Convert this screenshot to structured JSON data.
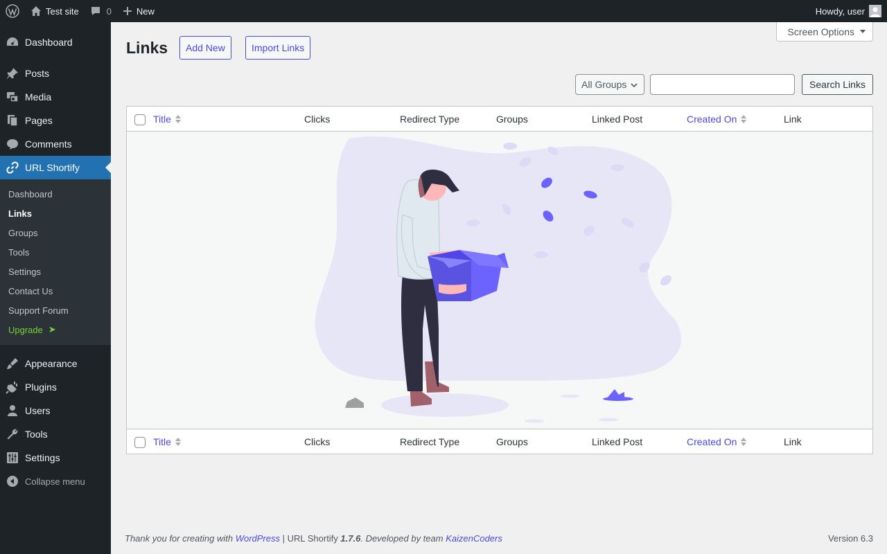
{
  "adminbar": {
    "site_name": "Test site",
    "comments_count": "0",
    "new_label": "New",
    "howdy": "Howdy, user"
  },
  "sidebar": {
    "items": [
      {
        "label": "Dashboard",
        "icon": "dashboard-icon"
      },
      {
        "label": "Posts",
        "icon": "pin-icon"
      },
      {
        "label": "Media",
        "icon": "media-icon"
      },
      {
        "label": "Pages",
        "icon": "pages-icon"
      },
      {
        "label": "Comments",
        "icon": "comment-icon"
      },
      {
        "label": "URL Shortify",
        "icon": "link-icon",
        "current": true
      }
    ],
    "submenu": [
      "Dashboard",
      "Links",
      "Groups",
      "Tools",
      "Settings",
      "Contact Us",
      "Support Forum",
      "Upgrade"
    ],
    "upgrade_arrow": "➤",
    "items_after": [
      {
        "label": "Appearance",
        "icon": "brush-icon"
      },
      {
        "label": "Plugins",
        "icon": "plug-icon"
      },
      {
        "label": "Users",
        "icon": "user-icon"
      },
      {
        "label": "Tools",
        "icon": "wrench-icon"
      },
      {
        "label": "Settings",
        "icon": "sliders-icon"
      }
    ],
    "collapse": "Collapse menu"
  },
  "main": {
    "screen_options": "Screen Options",
    "title": "Links",
    "add_new": "Add New",
    "import_links": "Import Links",
    "groups_select": "All Groups",
    "search_button": "Search Links",
    "search_value": ""
  },
  "table": {
    "columns": [
      "Title",
      "Clicks",
      "Redirect Type",
      "Groups",
      "Linked Post",
      "Created On",
      "Link"
    ]
  },
  "footer": {
    "prefix": "Thank you for creating with ",
    "wordpress": "WordPress",
    "mid": " | URL Shortify ",
    "version_num": "1.7.6",
    "dev": ". Developed by team ",
    "team": "KaizenCoders",
    "version": "Version 6.3"
  },
  "colors": {
    "accent": "#4f46e5",
    "menu_current": "#2271b1",
    "upgrade": "#7ad03a"
  }
}
